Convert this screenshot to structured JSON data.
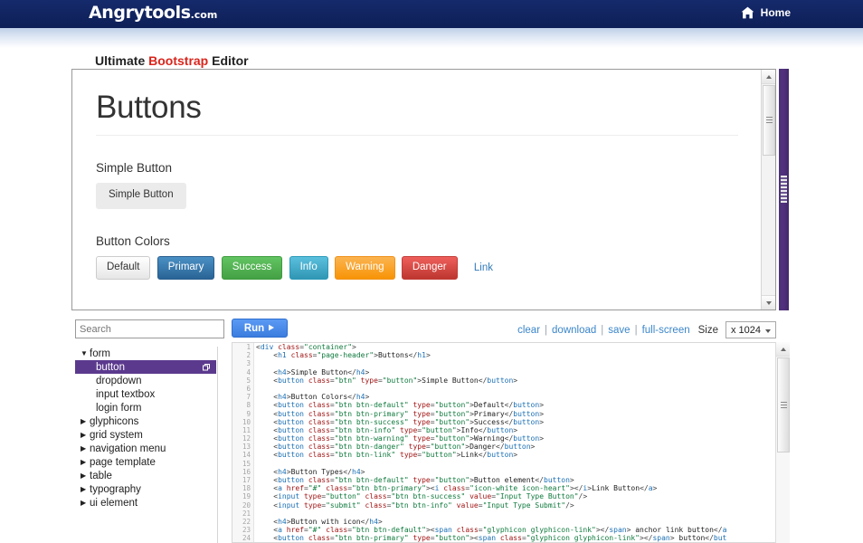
{
  "topbar": {
    "brand_name": "Angrytools",
    "brand_tld": ".com",
    "home_label": "Home",
    "home_icon": "home-icon",
    "background_color": "#11225e"
  },
  "page": {
    "title_prefix": "Ultimate ",
    "title_highlight": "Bootstrap",
    "title_suffix": " Editor",
    "highlight_color": "#d9251c"
  },
  "preview": {
    "heading": "Buttons",
    "sections": [
      {
        "heading": "Simple Button",
        "buttons": [
          {
            "label": "Simple Button",
            "style": "simple"
          }
        ]
      },
      {
        "heading": "Button Colors",
        "buttons": [
          {
            "label": "Default",
            "style": "default"
          },
          {
            "label": "Primary",
            "style": "primary"
          },
          {
            "label": "Success",
            "style": "success"
          },
          {
            "label": "Info",
            "style": "info"
          },
          {
            "label": "Warning",
            "style": "warning"
          },
          {
            "label": "Danger",
            "style": "danger"
          }
        ],
        "link_label": "Link"
      }
    ],
    "resize_handle_color": "#52307f"
  },
  "toolbar": {
    "search_placeholder": "Search",
    "search_value": "",
    "run_label": "Run",
    "run_icon": "play-icon",
    "links": [
      "clear",
      "download",
      "save",
      "full-screen"
    ],
    "separator": "|",
    "size_label": "Size",
    "size_value": "x 1024"
  },
  "sidebar": {
    "groups": [
      {
        "label": "form",
        "expanded": true,
        "caret": "▼",
        "children": [
          {
            "label": "button",
            "selected": true,
            "icon": "external-window-icon"
          },
          {
            "label": "dropdown",
            "selected": false
          },
          {
            "label": "input textbox",
            "selected": false
          },
          {
            "label": "login form",
            "selected": false
          }
        ]
      },
      {
        "label": "glyphicons",
        "expanded": false,
        "caret": "▶",
        "children": []
      },
      {
        "label": "grid system",
        "expanded": false,
        "caret": "▶",
        "children": []
      },
      {
        "label": "navigation menu",
        "expanded": false,
        "caret": "▶",
        "children": []
      },
      {
        "label": "page template",
        "expanded": false,
        "caret": "▶",
        "children": []
      },
      {
        "label": "table",
        "expanded": false,
        "caret": "▶",
        "children": []
      },
      {
        "label": "typography",
        "expanded": false,
        "caret": "▶",
        "children": []
      },
      {
        "label": "ui element",
        "expanded": false,
        "caret": "▶",
        "children": []
      }
    ],
    "selected_background": "#5b3a8e"
  },
  "editor": {
    "first_line": 1,
    "lines": [
      "<div class=\"container\">",
      "    <h1 class=\"page-header\">Buttons</h1>",
      "",
      "    <h4>Simple Button</h4>",
      "    <button class=\"btn\" type=\"button\">Simple Button</button>",
      "",
      "    <h4>Button Colors</h4>",
      "    <button class=\"btn btn-default\" type=\"button\">Default</button>",
      "    <button class=\"btn btn-primary\" type=\"button\">Primary</button>",
      "    <button class=\"btn btn-success\" type=\"button\">Success</button>",
      "    <button class=\"btn btn-info\" type=\"button\">Info</button>",
      "    <button class=\"btn btn-warning\" type=\"button\">Warning</button>",
      "    <button class=\"btn btn-danger\" type=\"button\">Danger</button>",
      "    <button class=\"btn btn-link\" type=\"button\">Link</button>",
      "",
      "    <h4>Button Types</h4>",
      "    <button class=\"btn btn-default\" type=\"button\">Button element</button>",
      "    <a href=\"#\" class=\"btn btn-primary\"><i class=\"icon-white icon-heart\"></i>Link Button</a>",
      "    <input type=\"button\" class=\"btn btn-success\" value=\"Input Type Button\"/>",
      "    <input type=\"submit\" class=\"btn btn-info\" value=\"Input Type Submit\"/>",
      "",
      "    <h4>Button with icon</h4>",
      "    <a href=\"#\" class=\"btn btn-default\"><span class=\"glyphicon glyphicon-link\"></span> anchor link button</a",
      "    <button class=\"btn btn-primary\" type=\"button\"><span class=\"glyphicon glyphicon-link\"></span> button</but"
    ]
  }
}
